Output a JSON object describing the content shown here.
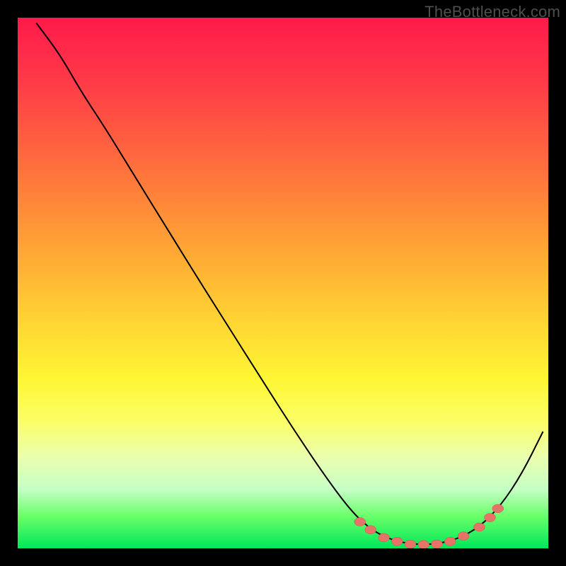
{
  "watermark": "TheBottleneck.com",
  "chart_data": {
    "type": "line",
    "title": "",
    "xlabel": "",
    "ylabel": "",
    "xlim": [
      0,
      100
    ],
    "ylim": [
      0,
      100
    ],
    "grid": false,
    "series": [
      {
        "name": "curve",
        "points": [
          {
            "x": 3.5,
            "y": 99.0
          },
          {
            "x": 8.0,
            "y": 93.0
          },
          {
            "x": 12.0,
            "y": 86.0
          },
          {
            "x": 16.5,
            "y": 79.2
          },
          {
            "x": 22.0,
            "y": 70.2
          },
          {
            "x": 28.0,
            "y": 60.5
          },
          {
            "x": 34.0,
            "y": 50.8
          },
          {
            "x": 40.0,
            "y": 41.3
          },
          {
            "x": 46.0,
            "y": 31.8
          },
          {
            "x": 52.0,
            "y": 22.4
          },
          {
            "x": 58.0,
            "y": 13.5
          },
          {
            "x": 63.0,
            "y": 6.8
          },
          {
            "x": 67.0,
            "y": 3.2
          },
          {
            "x": 71.0,
            "y": 1.4
          },
          {
            "x": 75.0,
            "y": 0.7
          },
          {
            "x": 79.0,
            "y": 0.8
          },
          {
            "x": 83.0,
            "y": 1.8
          },
          {
            "x": 87.0,
            "y": 4.0
          },
          {
            "x": 91.0,
            "y": 8.0
          },
          {
            "x": 95.0,
            "y": 14.0
          },
          {
            "x": 99.0,
            "y": 22.0
          }
        ]
      }
    ],
    "markers": [
      {
        "x": 64.5,
        "y": 5.0
      },
      {
        "x": 66.5,
        "y": 3.5
      },
      {
        "x": 69.0,
        "y": 2.0
      },
      {
        "x": 71.5,
        "y": 1.3
      },
      {
        "x": 74.0,
        "y": 0.8
      },
      {
        "x": 76.5,
        "y": 0.7
      },
      {
        "x": 79.0,
        "y": 0.8
      },
      {
        "x": 81.5,
        "y": 1.3
      },
      {
        "x": 84.0,
        "y": 2.3
      },
      {
        "x": 87.0,
        "y": 4.0
      },
      {
        "x": 89.0,
        "y": 5.8
      },
      {
        "x": 90.5,
        "y": 7.5
      }
    ],
    "background": {
      "type": "vertical-gradient",
      "stops": [
        {
          "pos": 0.0,
          "color": "#ff1a4a"
        },
        {
          "pos": 0.12,
          "color": "#ff3a48"
        },
        {
          "pos": 0.28,
          "color": "#ff6f3d"
        },
        {
          "pos": 0.42,
          "color": "#ffa035"
        },
        {
          "pos": 0.58,
          "color": "#ffd733"
        },
        {
          "pos": 0.68,
          "color": "#fff633"
        },
        {
          "pos": 0.76,
          "color": "#fbff66"
        },
        {
          "pos": 0.83,
          "color": "#eaffb0"
        },
        {
          "pos": 0.89,
          "color": "#c4ffc4"
        },
        {
          "pos": 0.94,
          "color": "#68ff68"
        },
        {
          "pos": 1.0,
          "color": "#00e85a"
        }
      ]
    }
  }
}
